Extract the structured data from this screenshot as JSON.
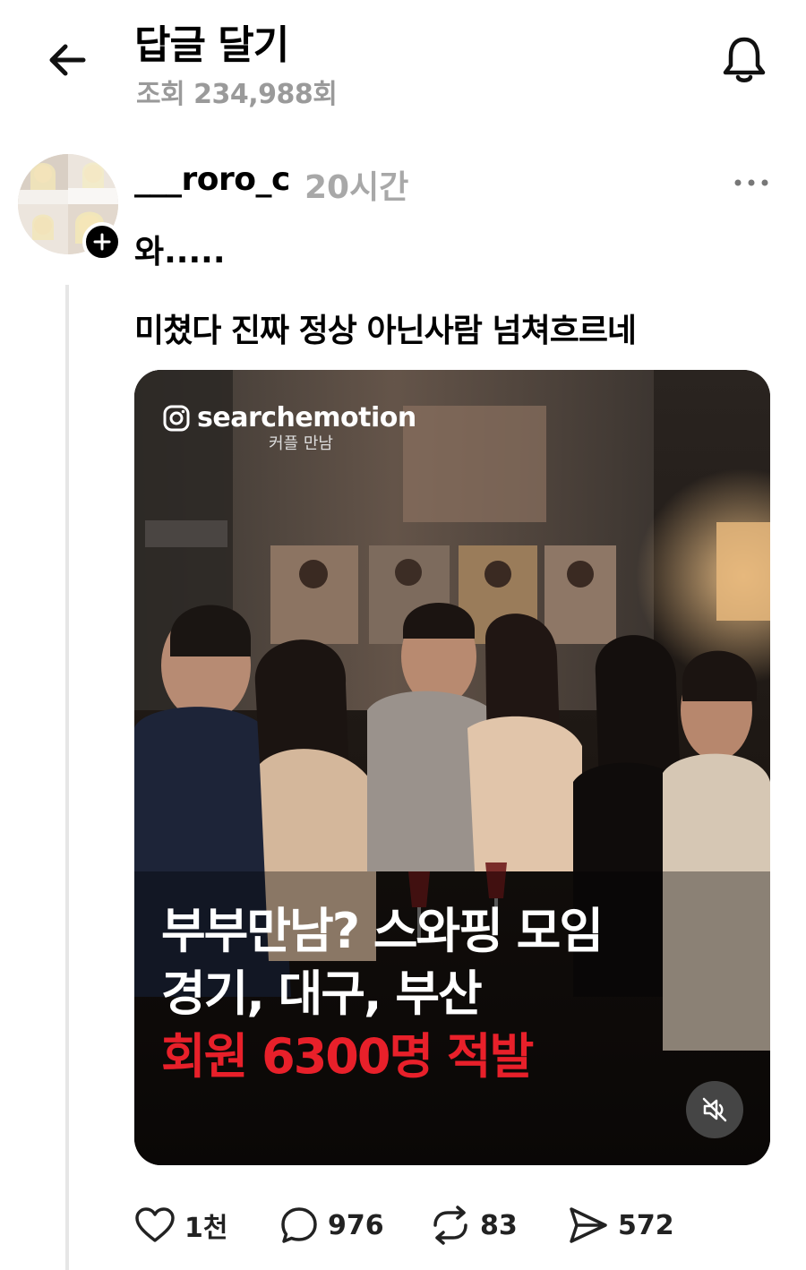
{
  "header": {
    "title": "답글 달기",
    "views": "조회 234,988회"
  },
  "post": {
    "username": "___roro_c",
    "time": "20시간",
    "text": "와.....",
    "reply_text": "미쳤다 진짜 정상 아닌사람 넘쳐흐르네"
  },
  "media": {
    "handle": "searchemotion",
    "screen_title": "커플 만남",
    "headline_line1": "부부만남? 스와핑 모임",
    "headline_line2": "경기, 대구, 부산",
    "headline_line3": "회원 6300명 적발",
    "headline_accent_color": "#e8202a"
  },
  "actions": {
    "likes": "1천",
    "comments": "976",
    "reposts": "83",
    "shares": "572"
  }
}
